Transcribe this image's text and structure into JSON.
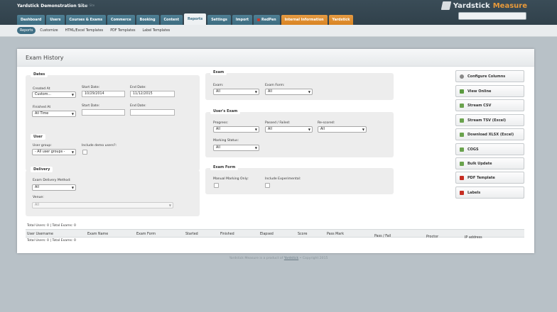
{
  "header": {
    "site_title": "Yardstick Demonstration Site",
    "change_site": "Change Site",
    "brand_name": "Yardstick",
    "brand_sub": "Measure"
  },
  "tabs": [
    {
      "label": "Dashboard"
    },
    {
      "label": "Users"
    },
    {
      "label": "Courses & Exams"
    },
    {
      "label": "Commerce"
    },
    {
      "label": "Booking"
    },
    {
      "label": "Content"
    },
    {
      "label": "Reports"
    },
    {
      "label": "Settings"
    },
    {
      "label": "Import"
    },
    {
      "label": "RedPen"
    },
    {
      "label": "Internal Information"
    },
    {
      "label": "Yardstick"
    }
  ],
  "subtabs": [
    {
      "label": "Reports"
    },
    {
      "label": "Customize"
    },
    {
      "label": "HTML/Excel Templates"
    },
    {
      "label": "PDF Templates"
    },
    {
      "label": "Label Templates"
    }
  ],
  "page_title": "Exam History",
  "dates": {
    "legend": "Dates",
    "created_at_label": "Created At",
    "created_at_value": "Custom...",
    "start_date_label": "Start Date:",
    "start_date_value": "10/29/2014",
    "end_date_label": "End Date:",
    "end_date_value": "11/12/2015",
    "finished_at_label": "Finished At",
    "finished_at_value": "All Time",
    "start_date2_label": "Start Date:",
    "end_date2_label": "End Date:"
  },
  "user": {
    "legend": "User",
    "group_label": "User group:",
    "group_value": "- All user groups -",
    "demo_label": "Include demo users?:"
  },
  "delivery": {
    "legend": "Delivery",
    "method_label": "Exam Delivery Method:",
    "method_value": "All",
    "venue_label": "Venue:",
    "venue_value": "All"
  },
  "exam": {
    "legend": "Exam",
    "exam_label": "Exam:",
    "exam_value": "All",
    "form_label": "Exam Form:",
    "form_value": "All"
  },
  "users_exam": {
    "legend": "User's Exam",
    "progress_label": "Progress:",
    "progress_value": "All",
    "passed_label": "Passed / Failed:",
    "passed_value": "All",
    "rescored_label": "Re-scored:",
    "rescored_value": "All",
    "marking_label": "Marking Status:",
    "marking_value": "All"
  },
  "exam_form": {
    "legend": "Exam Form",
    "manual_label": "Manual Marking Only:",
    "experimental_label": "Include Experimental:"
  },
  "buttons": [
    {
      "label": "Configure Columns",
      "icon": "gear-icon"
    },
    {
      "label": "View Online",
      "icon": "view-icon"
    },
    {
      "label": "Stream CSV",
      "icon": "csv-icon"
    },
    {
      "label": "Stream TSV (Excel)",
      "icon": "tsv-icon"
    },
    {
      "label": "Download XLSX (Excel)",
      "icon": "xlsx-icon"
    },
    {
      "label": "COGS",
      "icon": "cogs-icon"
    },
    {
      "label": "Bulk Update",
      "icon": "bulk-update-icon"
    },
    {
      "label": "PDF Template",
      "icon": "pdf-icon"
    },
    {
      "label": "Labels",
      "icon": "labels-icon"
    }
  ],
  "results": {
    "summary_top": "Total Users: 0 | Total Exams: 0",
    "summary_bottom": "Total Users: 0 | Total Exams: 0",
    "columns": [
      "User Username",
      "Exam Name",
      "Exam Form",
      "Started",
      "Finished",
      "Elapsed",
      "Score",
      "Pass Mark",
      "Pass / Fail",
      "Proctor",
      "IP address"
    ]
  },
  "footer": {
    "prefix": "Yardstick Measure is a product of",
    "link": "Yardstick",
    "suffix": "• Copyright 2015"
  }
}
